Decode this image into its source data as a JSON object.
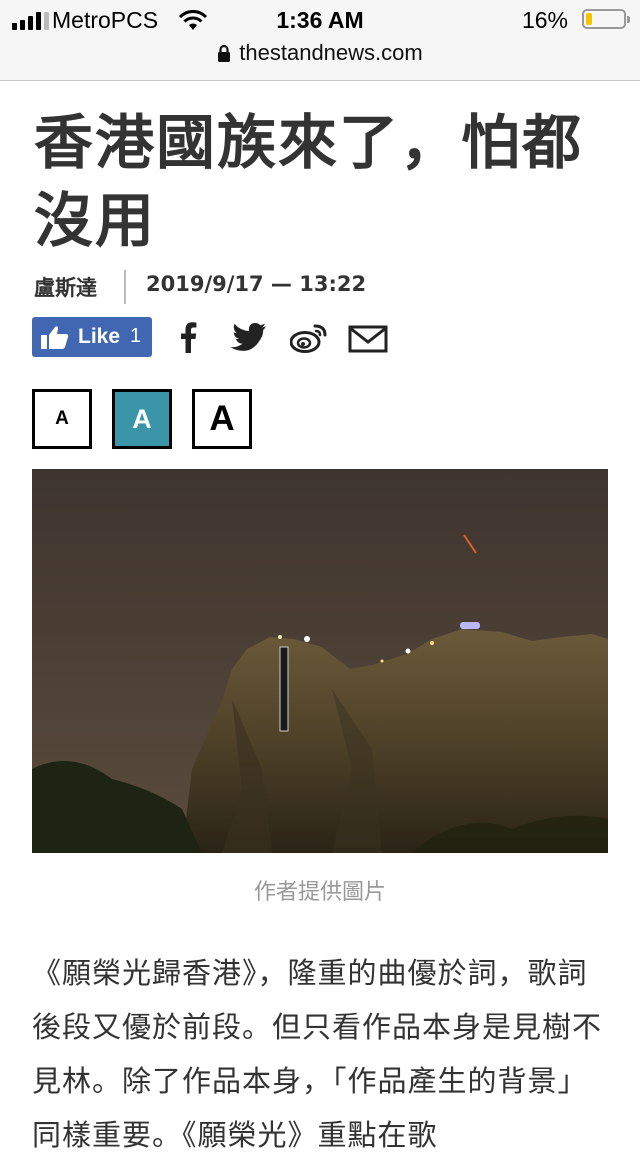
{
  "status_bar": {
    "carrier": "MetroPCS",
    "time": "1:36 AM",
    "battery_percent": "16%",
    "battery_level": 0.16,
    "icons": [
      "signal-icon",
      "wifi-icon",
      "battery-icon"
    ]
  },
  "browser": {
    "url": "thestandnews.com",
    "lock_icon": "lock-icon"
  },
  "article": {
    "title": "香港國族來了，怕都沒用",
    "author": "盧斯達",
    "datetime": "2019/9/17 — 13:22",
    "like_label": "Like",
    "like_count": "1",
    "share_icons": [
      "facebook-icon",
      "twitter-icon",
      "weibo-icon",
      "email-icon"
    ],
    "font_size_options": [
      "A",
      "A",
      "A"
    ],
    "font_size_selected": 1,
    "image_caption": "作者提供圖片",
    "body_text": "《願榮光歸香港》，隆重的曲優於詞，歌詞後段又優於前段。但只看作品本身是見樹不見林。除了作品本身，「作品產生的背景」同樣重要。《願榮光》重點在歌",
    "accent_color": "#3a95a8",
    "facebook_color": "#4267b2"
  }
}
